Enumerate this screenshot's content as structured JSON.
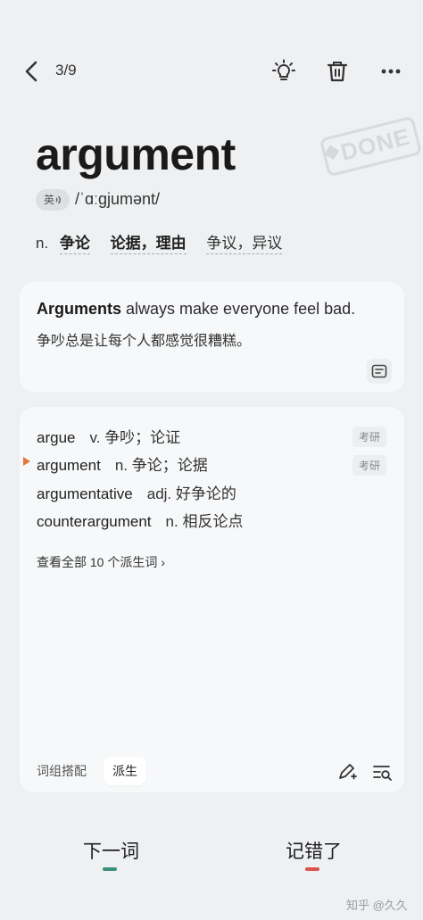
{
  "header": {
    "counter": "3/9"
  },
  "word": {
    "headword": "argument",
    "stamp": "DONE",
    "accent": "英",
    "phonetic": "/ˈɑːɡjumənt/",
    "pos": "n.",
    "meanings": [
      "争论",
      "论据，理由",
      "争议，异议"
    ]
  },
  "example": {
    "highlight": "Arguments",
    "rest": " always make everyone feel bad.",
    "translation": "争吵总是让每个人都感觉很糟糕。"
  },
  "derivatives": {
    "items": [
      {
        "word": "argue",
        "pos": "v.",
        "meaning": "争吵；论证",
        "tag": "考研"
      },
      {
        "word": "argument",
        "pos": "n.",
        "meaning": "争论；论据",
        "tag": "考研"
      },
      {
        "word": "argumentative",
        "pos": "adj.",
        "meaning": "好争论的",
        "tag": ""
      },
      {
        "word": "counterargument",
        "pos": "n.",
        "meaning": "相反论点",
        "tag": ""
      }
    ],
    "view_all": "查看全部 10 个派生词",
    "tabs": [
      "词组搭配",
      "派生"
    ]
  },
  "actions": {
    "next": "下一词",
    "wrong": "记错了"
  },
  "colors": {
    "next_bar": "#3f8f7f",
    "wrong_bar": "#d9534f",
    "current_marker": "#e07a3b"
  },
  "watermark": "知乎 @久久"
}
